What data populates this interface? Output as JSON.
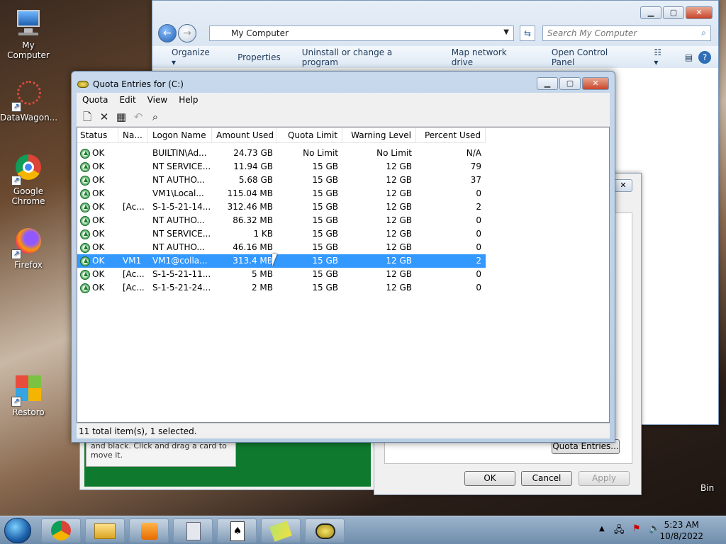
{
  "desktop": {
    "icons": [
      {
        "label": "My Computer"
      },
      {
        "label": "DataWagon..."
      },
      {
        "label": "Google Chrome"
      },
      {
        "label": "Firefox"
      },
      {
        "label": "Restoro"
      }
    ],
    "recycle_bin_label": "Bin"
  },
  "explorer": {
    "address": "My Computer",
    "search_placeholder": "Search My Computer",
    "toolbar": [
      "Organize ▾",
      "Properties",
      "Uninstall or change a program",
      "Map network drive",
      "Open Control Panel"
    ],
    "help_icon": "?"
  },
  "properties_dialog": {
    "quota_entries_button": "Quota Entries...",
    "ok": "OK",
    "cancel": "Cancel",
    "apply": "Apply"
  },
  "solitaire": {
    "hint": "and black. Click and drag a card to move it."
  },
  "quota": {
    "title": "Quota Entries for  (C:)",
    "menu": [
      "Quota",
      "Edit",
      "View",
      "Help"
    ],
    "columns": [
      "Status",
      "Na...",
      "Logon Name",
      "Amount Used",
      "Quota Limit",
      "Warning Level",
      "Percent Used"
    ],
    "rows": [
      {
        "status": "OK",
        "name": "",
        "logon": "BUILTIN\\Ad...",
        "amount": "24.73 GB",
        "limit": "No Limit",
        "warn": "No Limit",
        "pct": "N/A"
      },
      {
        "status": "OK",
        "name": "",
        "logon": "NT SERVICE...",
        "amount": "11.94 GB",
        "limit": "15 GB",
        "warn": "12 GB",
        "pct": "79"
      },
      {
        "status": "OK",
        "name": "",
        "logon": "NT AUTHO...",
        "amount": "5.68 GB",
        "limit": "15 GB",
        "warn": "12 GB",
        "pct": "37"
      },
      {
        "status": "OK",
        "name": "",
        "logon": "VM1\\Local...",
        "amount": "115.04 MB",
        "limit": "15 GB",
        "warn": "12 GB",
        "pct": "0"
      },
      {
        "status": "OK",
        "name": "[Ac...",
        "logon": "S-1-5-21-14...",
        "amount": "312.46 MB",
        "limit": "15 GB",
        "warn": "12 GB",
        "pct": "2"
      },
      {
        "status": "OK",
        "name": "",
        "logon": "NT AUTHO...",
        "amount": "86.32 MB",
        "limit": "15 GB",
        "warn": "12 GB",
        "pct": "0"
      },
      {
        "status": "OK",
        "name": "",
        "logon": "NT SERVICE...",
        "amount": "1 KB",
        "limit": "15 GB",
        "warn": "12 GB",
        "pct": "0"
      },
      {
        "status": "OK",
        "name": "",
        "logon": "NT AUTHO...",
        "amount": "46.16 MB",
        "limit": "15 GB",
        "warn": "12 GB",
        "pct": "0"
      },
      {
        "status": "OK",
        "name": "VM1",
        "logon": "VM1@colla...",
        "amount": "313.4 MB",
        "limit": "15 GB",
        "warn": "12 GB",
        "pct": "2",
        "selected": true
      },
      {
        "status": "OK",
        "name": "[Ac...",
        "logon": "S-1-5-21-11...",
        "amount": "5 MB",
        "limit": "15 GB",
        "warn": "12 GB",
        "pct": "0"
      },
      {
        "status": "OK",
        "name": "[Ac...",
        "logon": "S-1-5-21-24...",
        "amount": "2 MB",
        "limit": "15 GB",
        "warn": "12 GB",
        "pct": "0"
      }
    ],
    "status_bar": "11 total item(s), 1 selected."
  },
  "taskbar": {
    "time": "5:23 AM",
    "date": "10/8/2022"
  }
}
